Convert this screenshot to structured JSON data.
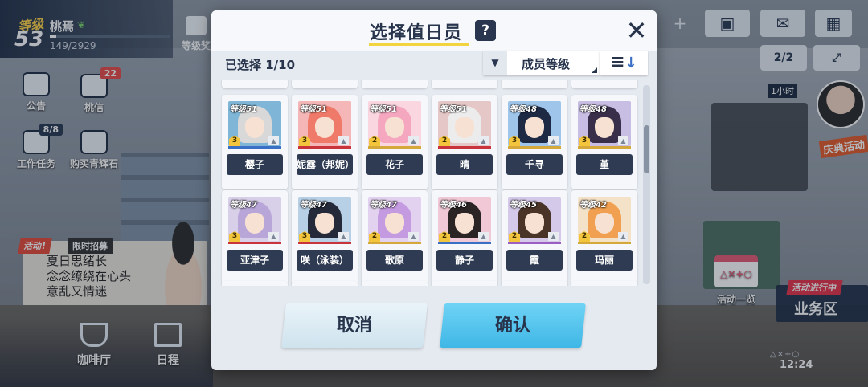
{
  "player": {
    "level_label": "等级",
    "level": "53",
    "name": "桃焉",
    "exp": "149/2929",
    "exp_fraction": 0.051
  },
  "topbar": {
    "level_reward_label": "等级奖"
  },
  "sidebar": {
    "items": [
      {
        "label": "公告",
        "badge": ""
      },
      {
        "label": "桃信",
        "badge": "22"
      },
      {
        "label": "工作任务",
        "badge": "8/8"
      },
      {
        "label": "购买青辉石",
        "badge": ""
      }
    ]
  },
  "banner": {
    "tag": "活动!",
    "tag2": "限时招募",
    "lines": [
      "夏日思绪长",
      "念念缭绕在心头",
      "意乱又情迷"
    ]
  },
  "bottom_nav": [
    {
      "label": "咖啡厅"
    },
    {
      "label": "日程"
    }
  ],
  "top_right": {
    "plus": "+",
    "counter": "2/2"
  },
  "event": {
    "timer": "1小时",
    "label": "庆典活动"
  },
  "calendar": {
    "label": "活动一览",
    "shapes": "△×+○"
  },
  "business": {
    "tag": "活动进行中",
    "label": "业务区"
  },
  "status": {
    "shapes": "△×+○",
    "clock": "12:24"
  },
  "modal": {
    "title": "选择值日员",
    "help": "?",
    "close": "✕",
    "selected_count": "已选择 1/10",
    "sort_label": "成员等级",
    "cancel_label": "取消",
    "confirm_label": "确认"
  },
  "members": [
    {
      "name": "樱子",
      "level": "等级51",
      "stars": "3",
      "hair": "#d8d8d8",
      "bg": "#7fb6d8",
      "rarity": "#3a6fc6"
    },
    {
      "name": "妮露（邦妮）",
      "level": "等级51",
      "stars": "3",
      "hair": "#f07a6a",
      "bg": "#f4b6b6",
      "rarity": "#c9343c"
    },
    {
      "name": "花子",
      "level": "等级51",
      "stars": "2",
      "hair": "#f5a7c0",
      "bg": "#f9d6e0",
      "rarity": "#d4a83a"
    },
    {
      "name": "晴",
      "level": "等级51",
      "stars": "2",
      "hair": "#ececec",
      "bg": "#e6c7c7",
      "rarity": "#c9343c"
    },
    {
      "name": "千寻",
      "level": "等级48",
      "stars": "3",
      "hair": "#1e2a44",
      "bg": "#9fc6ea",
      "rarity": "#d4a83a"
    },
    {
      "name": "堇",
      "level": "等级48",
      "stars": "3",
      "hair": "#3a2f4a",
      "bg": "#c8bde2",
      "rarity": "#d4a83a"
    },
    {
      "name": "亚津子",
      "level": "等级47",
      "stars": "3",
      "hair": "#b8a6d8",
      "bg": "#d8cfe8",
      "rarity": "#c9343c"
    },
    {
      "name": "咲（泳装）",
      "level": "等级47",
      "stars": "3",
      "hair": "#242a3a",
      "bg": "#b8d0e6",
      "rarity": "#c9343c"
    },
    {
      "name": "歌原",
      "level": "等级47",
      "stars": "2",
      "hair": "#c49ae0",
      "bg": "#e2d2f0",
      "rarity": "#d4a83a"
    },
    {
      "name": "静子",
      "level": "等级46",
      "stars": "2",
      "hair": "#2b2424",
      "bg": "#f0c8d6",
      "rarity": "#3a6fc6"
    },
    {
      "name": "霞",
      "level": "等级45",
      "stars": "2",
      "hair": "#4a3428",
      "bg": "#d4c9e8",
      "rarity": "#9b5fc4"
    },
    {
      "name": "玛丽",
      "level": "等级42",
      "stars": "2",
      "hair": "#f0a050",
      "bg": "#f4e2c8",
      "rarity": "#d4a83a"
    }
  ]
}
